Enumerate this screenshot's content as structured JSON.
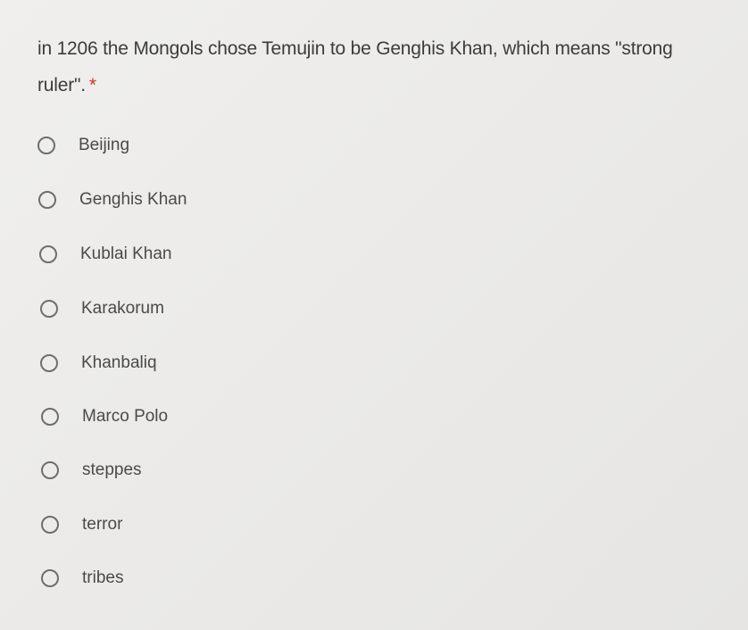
{
  "question": {
    "text": "in 1206 the Mongols chose Temujin to be Genghis Khan, which means \"strong ruler\".",
    "required_marker": "*"
  },
  "options": [
    {
      "label": "Beijing",
      "selected": false
    },
    {
      "label": "Genghis Khan",
      "selected": false
    },
    {
      "label": "Kublai Khan",
      "selected": false
    },
    {
      "label": "Karakorum",
      "selected": false
    },
    {
      "label": "Khanbaliq",
      "selected": false
    },
    {
      "label": "Marco Polo",
      "selected": false
    },
    {
      "label": "steppes",
      "selected": false
    },
    {
      "label": "terror",
      "selected": false
    },
    {
      "label": "tribes",
      "selected": false
    }
  ],
  "colors": {
    "required": "#d93025",
    "text": "#3c3c3c",
    "radio_border": "#6e6e6e"
  }
}
